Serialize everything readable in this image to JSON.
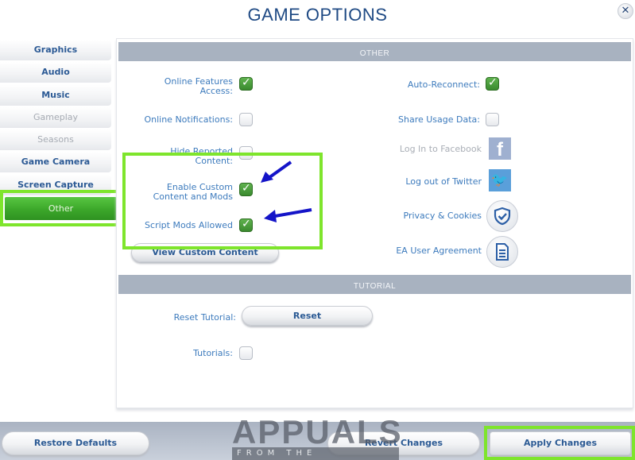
{
  "window": {
    "title": "Game Options",
    "close_label": "✕"
  },
  "sidebar": {
    "items": [
      {
        "label": "Graphics",
        "state": "enabled"
      },
      {
        "label": "Audio",
        "state": "enabled"
      },
      {
        "label": "Music",
        "state": "enabled"
      },
      {
        "label": "Gameplay",
        "state": "disabled"
      },
      {
        "label": "Seasons",
        "state": "disabled"
      },
      {
        "label": "Game Camera",
        "state": "enabled"
      },
      {
        "label": "Screen Capture",
        "state": "enabled"
      },
      {
        "label": "Other",
        "state": "active"
      }
    ]
  },
  "other_section": {
    "header": "Other",
    "left_options": [
      {
        "label_line1": "Online Features",
        "label_line2": "Access:",
        "checked": true
      },
      {
        "label_line1": "Online Notifications:",
        "label_line2": "",
        "checked": false
      },
      {
        "label_line1": "Hide Reported",
        "label_line2": "Content:",
        "checked": false
      },
      {
        "label_line1": "Enable Custom",
        "label_line2": "Content and Mods",
        "checked": true
      },
      {
        "label_line1": "Script Mods Allowed",
        "label_line2": "",
        "checked": true
      }
    ],
    "view_custom_content_label": "View Custom Content",
    "right_options": [
      {
        "label": "Auto-Reconnect:",
        "checked": true
      },
      {
        "label": "Share Usage Data:",
        "checked": false
      }
    ],
    "links": [
      {
        "label": "Log In to Facebook",
        "icon": "facebook-icon",
        "enabled": false
      },
      {
        "label": "Log out of Twitter",
        "icon": "twitter-icon",
        "enabled": true
      },
      {
        "label": "Privacy & Cookies",
        "icon": "shield-check-icon",
        "enabled": true
      },
      {
        "label": "EA User Agreement",
        "icon": "document-icon",
        "enabled": true
      }
    ]
  },
  "tutorial_section": {
    "header": "Tutorial",
    "reset_label": "Reset Tutorial:",
    "reset_button": "Reset",
    "tutorials_label": "Tutorials:",
    "tutorials_checked": false
  },
  "footer": {
    "restore_defaults": "Restore Defaults",
    "revert_changes": "Revert Changes",
    "apply_changes": "Apply Changes"
  },
  "watermark": {
    "brand": "APPUALS",
    "tagline": "FROM THE EXPERTS!"
  },
  "annotation": {
    "highlight_color": "#7ee52c",
    "arrow_color": "#1414c8"
  }
}
